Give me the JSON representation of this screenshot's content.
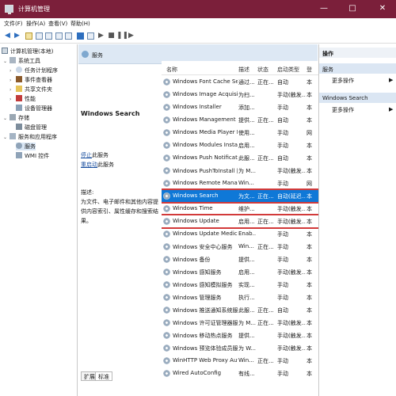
{
  "window": {
    "title": "计算机管理",
    "controls": [
      "—",
      "□",
      "✕"
    ]
  },
  "menubar": [
    "文件(F)",
    "操作(A)",
    "查看(V)",
    "帮助(H)"
  ],
  "tree": {
    "root": "计算机管理(本地)",
    "system_tools": "系统工具",
    "task_scheduler": "任务计划程序",
    "event_viewer": "事件查看器",
    "shared_folders": "共享文件夹",
    "performance": "性能",
    "device_manager": "设备管理器",
    "storage": "存储",
    "disk_management": "磁盘管理",
    "services_apps": "服务和应用程序",
    "services": "服务",
    "wmi": "WMI 控件"
  },
  "center": {
    "header": "服务",
    "selected_service": "Windows Search",
    "stop_link": "停止",
    "stop_tail": "此服务",
    "restart_link": "重启动",
    "restart_tail": "此服务",
    "desc_label": "描述:",
    "desc_text": "为文件、电子邮件和其他内容提供内容索引、属性缓存和搜索结果。",
    "columns": [
      "名称",
      "描述",
      "状态",
      "启动类型",
      "登"
    ],
    "rows": [
      {
        "name": "Windows Font Cache Servi...",
        "desc": "通过...",
        "status": "正在...",
        "startup": "自动",
        "logon": "本"
      },
      {
        "name": "Windows Image Acquisitio...",
        "desc": "为扫...",
        "status": "",
        "startup": "手动(触发...",
        "logon": "本"
      },
      {
        "name": "Windows Installer",
        "desc": "添加...",
        "status": "",
        "startup": "手动",
        "logon": "本"
      },
      {
        "name": "Windows Management Ins...",
        "desc": "提供...",
        "status": "正在...",
        "startup": "自动",
        "logon": "本"
      },
      {
        "name": "Windows Media Player Net...",
        "desc": "使用...",
        "status": "",
        "startup": "手动",
        "logon": "网"
      },
      {
        "name": "Windows Modules Installer",
        "desc": "启用...",
        "status": "",
        "startup": "手动",
        "logon": "本"
      },
      {
        "name": "Windows Push Notification...",
        "desc": "此服...",
        "status": "正在...",
        "startup": "自动",
        "logon": "本"
      },
      {
        "name": "Windows PushToInstall 服务",
        "desc": "为 M...",
        "status": "",
        "startup": "手动(触发...",
        "logon": "本"
      },
      {
        "name": "Windows Remote Manage...",
        "desc": "Win...",
        "status": "",
        "startup": "手动",
        "logon": "网"
      },
      {
        "name": "Windows Search",
        "desc": "为文...",
        "status": "正在...",
        "startup": "自动(延迟...",
        "logon": "本"
      },
      {
        "name": "Windows Time",
        "desc": "维护...",
        "status": "",
        "startup": "手动(触发...",
        "logon": "本"
      },
      {
        "name": "Windows Update",
        "desc": "启用...",
        "status": "正在...",
        "startup": "手动(触发...",
        "logon": "本"
      },
      {
        "name": "Windows Update Medic Se...",
        "desc": "Enab...",
        "status": "",
        "startup": "手动",
        "logon": "本"
      },
      {
        "name": "Windows 安全中心服务",
        "desc": "Win...",
        "status": "正在...",
        "startup": "手动",
        "logon": "本"
      },
      {
        "name": "Windows 备份",
        "desc": "提供...",
        "status": "",
        "startup": "手动",
        "logon": "本"
      },
      {
        "name": "Windows 感知服务",
        "desc": "启用...",
        "status": "",
        "startup": "手动(触发...",
        "logon": "本"
      },
      {
        "name": "Windows 感知模拟服务",
        "desc": "实现...",
        "status": "",
        "startup": "手动",
        "logon": "本"
      },
      {
        "name": "Windows 管理服务",
        "desc": "执行...",
        "status": "",
        "startup": "手动",
        "logon": "本"
      },
      {
        "name": "Windows 推送通知系统服务",
        "desc": "此服...",
        "status": "正在...",
        "startup": "自动",
        "logon": "本"
      },
      {
        "name": "Windows 许可证管理器服务",
        "desc": "为 M...",
        "status": "正在...",
        "startup": "手动(触发...",
        "logon": "本"
      },
      {
        "name": "Windows 移动热点服务",
        "desc": "提供...",
        "status": "",
        "startup": "手动(触发...",
        "logon": "本"
      },
      {
        "name": "Windows 预览体验成员服务",
        "desc": "为 W...",
        "status": "",
        "startup": "手动(触发...",
        "logon": "本"
      },
      {
        "name": "WinHTTP Web Proxy Auto...",
        "desc": "Win...",
        "status": "正在...",
        "startup": "手动",
        "logon": "本"
      },
      {
        "name": "Wired AutoConfig",
        "desc": "有线...",
        "status": "",
        "startup": "手动",
        "logon": "本"
      }
    ],
    "tabs": [
      "扩展",
      "标准"
    ]
  },
  "actions": {
    "header": "操作",
    "section1": "服务",
    "more1": "更多操作",
    "section2": "Windows Search",
    "more2": "更多操作"
  }
}
